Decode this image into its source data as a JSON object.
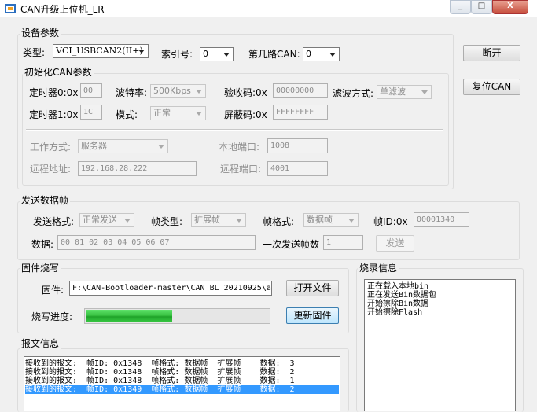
{
  "window": {
    "title": "CAN升级上位机_LR",
    "minimize": "_",
    "maximize": "□",
    "close": "X"
  },
  "device": {
    "group_title": "设备参数",
    "type_label": "类型:",
    "type_value": "VCI_USBCAN2(II+)",
    "index_label": "索引号:",
    "index_value": "0",
    "channel_label": "第几路CAN:",
    "channel_value": "0",
    "disconnect_button": "断开",
    "reset_button": "复位CAN"
  },
  "init": {
    "group_title": "初始化CAN参数",
    "timer0_label": "定时器0:0x",
    "timer0_value": "00",
    "timer1_label": "定时器1:0x",
    "timer1_value": "1C",
    "baud_label": "波特率:",
    "baud_value": "500Kbps",
    "mode_label": "模式:",
    "mode_value": "正常",
    "acc_code_label": "验收码:0x",
    "acc_code_value": "00000000",
    "mask_label": "屏蔽码:0x",
    "mask_value": "FFFFFFFF",
    "filter_label": "滤波方式:",
    "filter_value": "单滤波",
    "work_mode_label": "工作方式:",
    "work_mode_value": "服务器",
    "local_port_label": "本地端口:",
    "local_port_value": "1008",
    "remote_addr_label": "远程地址:",
    "remote_addr_value": "192.168.28.222",
    "remote_port_label": "远程端口:",
    "remote_port_value": "4001"
  },
  "send": {
    "group_title": "发送数据帧",
    "format_label": "发送格式:",
    "format_value": "正常发送",
    "frame_type_label": "帧类型:",
    "frame_type_value": "扩展帧",
    "frame_format_label": "帧格式:",
    "frame_format_value": "数据帧",
    "frame_id_label": "帧ID:0x",
    "frame_id_value": "00001340",
    "data_label": "数据:",
    "data_value": "00 01 02 03 04 05 06 07",
    "count_label": "一次发送帧数",
    "count_value": "1",
    "send_button": "发送"
  },
  "firmware": {
    "group_title": "固件烧写",
    "file_label": "固件:",
    "file_value": "F:\\CAN-Bootloader-master\\CAN_BL_20210925\\a",
    "open_button": "打开文件",
    "progress_label": "烧写进度:",
    "progress": 0.47,
    "update_button": "更新固件"
  },
  "burn_log": {
    "group_title": "烧录信息",
    "lines": [
      "正在载入本地bin",
      "正在发送Bin数据包",
      "开始擦除Bin数据",
      "开始擦除Flash"
    ]
  },
  "messages": {
    "group_title": "报文信息",
    "rows": [
      {
        "text": "接收到的报文:  帧ID: 0x1348  帧格式: 数据帧  扩展帧    数据:  3",
        "selected": false
      },
      {
        "text": "接收到的报文:  帧ID: 0x1348  帧格式: 数据帧  扩展帧    数据:  2",
        "selected": false
      },
      {
        "text": "接收到的报文:  帧ID: 0x1348  帧格式: 数据帧  扩展帧    数据:  1",
        "selected": false
      },
      {
        "text": "接收到的报文:  帧ID: 0x1349  帧格式: 数据帧  扩展帧    数据:  2",
        "selected": true
      }
    ]
  },
  "colors": {
    "selection": "#3399ff",
    "progress": "#37c040"
  }
}
